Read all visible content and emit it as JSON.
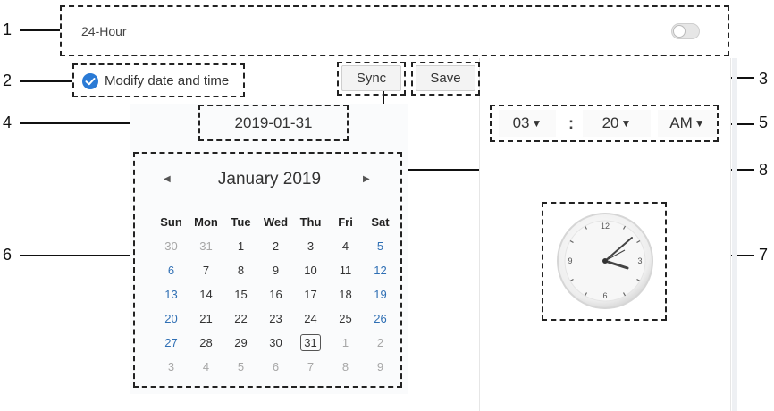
{
  "callouts": [
    "1",
    "2",
    "3",
    "4",
    "5",
    "6",
    "7",
    "8"
  ],
  "hour_mode": {
    "label": "24-Hour",
    "enabled": false
  },
  "modify": {
    "label": "Modify date and time",
    "checked": true
  },
  "buttons": {
    "sync": "Sync",
    "save": "Save"
  },
  "date_input": {
    "value": "2019-01-31"
  },
  "time": {
    "hour": "03",
    "separator": ":",
    "minute": "20",
    "ampm": "AM",
    "dropdown_glyph": "▼"
  },
  "calendar": {
    "month_label": "January 2019",
    "prev_glyph": "◀",
    "next_glyph": "▶",
    "weekdays": [
      "Sun",
      "Mon",
      "Tue",
      "Wed",
      "Thu",
      "Fri",
      "Sat"
    ],
    "weeks": [
      [
        "30",
        "31",
        "1",
        "2",
        "3",
        "4",
        "5"
      ],
      [
        "6",
        "7",
        "8",
        "9",
        "10",
        "11",
        "12"
      ],
      [
        "13",
        "14",
        "15",
        "16",
        "17",
        "18",
        "19"
      ],
      [
        "20",
        "21",
        "22",
        "23",
        "24",
        "25",
        "26"
      ],
      [
        "27",
        "28",
        "29",
        "30",
        "31",
        "1",
        "2"
      ],
      [
        "3",
        "4",
        "5",
        "6",
        "7",
        "8",
        "9"
      ]
    ],
    "selected_day": "31"
  },
  "clock": {
    "marks": [
      "12",
      "3",
      "6",
      "9"
    ]
  },
  "colors": {
    "accent": "#2f6fb4",
    "check": "#2a7ad5"
  }
}
